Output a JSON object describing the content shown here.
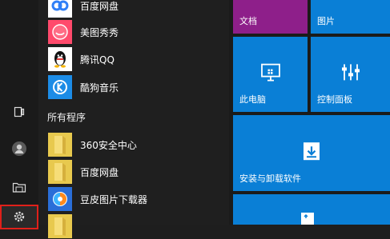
{
  "apps_top": [
    {
      "label": "百度网盘",
      "icon": "baidu-netdisk-icon",
      "bg": "#ffffff"
    },
    {
      "label": "美图秀秀",
      "icon": "meitu-icon",
      "bg": "#ff4a6c"
    },
    {
      "label": "腾讯QQ",
      "icon": "qq-penguin-icon",
      "bg": "#ffffff"
    },
    {
      "label": "酷狗音乐",
      "icon": "kugou-music-icon",
      "bg": "#1c8ce6"
    }
  ],
  "section_label": "所有程序",
  "apps_all": [
    {
      "label": "360安全中心",
      "icon": "folder-icon",
      "bg": "#e8c94e"
    },
    {
      "label": "百度网盘",
      "icon": "folder-icon",
      "bg": "#e8c94e"
    },
    {
      "label": "豆皮图片下载器",
      "icon": "doupi-downloader-icon",
      "bg": "#2a6ed8"
    },
    {
      "label": "",
      "icon": "folder-icon",
      "bg": "#e8c94e"
    }
  ],
  "tiles": {
    "documents": "文档",
    "pictures": "图片",
    "this_pc": "此电脑",
    "control_panel": "控制面板",
    "install_uninstall": "安装与卸载软件"
  },
  "colors": {
    "documents": "#8e1f8a",
    "blue": "#0a7fd6",
    "highlight": "#e0201a"
  }
}
